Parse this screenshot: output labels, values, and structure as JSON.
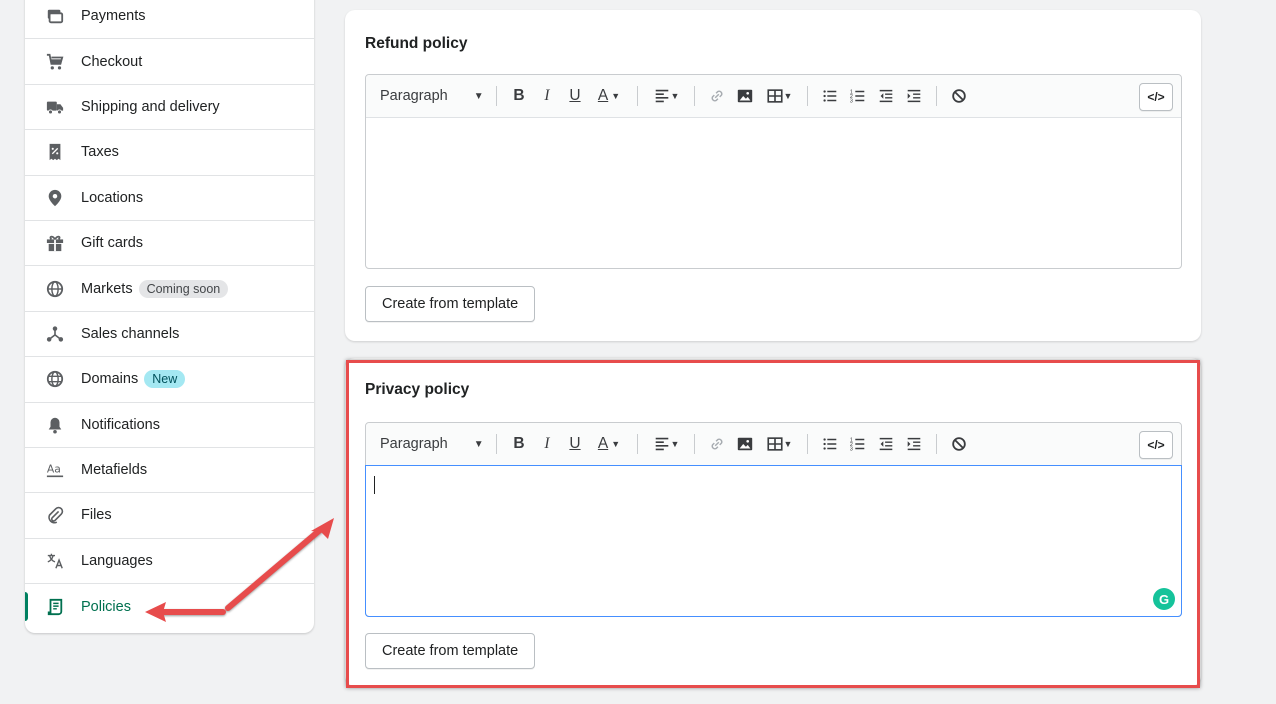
{
  "sidebar": {
    "items": [
      {
        "label": "Payments",
        "icon": "payments-icon"
      },
      {
        "label": "Checkout",
        "icon": "cart-icon"
      },
      {
        "label": "Shipping and delivery",
        "icon": "truck-icon"
      },
      {
        "label": "Taxes",
        "icon": "tax-receipt-icon"
      },
      {
        "label": "Locations",
        "icon": "location-pin-icon"
      },
      {
        "label": "Gift cards",
        "icon": "gift-icon"
      },
      {
        "label": "Markets",
        "icon": "globe-icon",
        "badge": "Coming soon"
      },
      {
        "label": "Sales channels",
        "icon": "channels-icon"
      },
      {
        "label": "Domains",
        "icon": "domain-globe-icon",
        "badge": "New"
      },
      {
        "label": "Notifications",
        "icon": "bell-icon"
      },
      {
        "label": "Metafields",
        "icon": "metafields-icon"
      },
      {
        "label": "Files",
        "icon": "paperclip-icon"
      },
      {
        "label": "Languages",
        "icon": "translate-icon"
      },
      {
        "label": "Policies",
        "icon": "policy-document-icon",
        "active": true
      }
    ]
  },
  "refund": {
    "title": "Refund policy",
    "paragraph": "Paragraph",
    "template_button": "Create from template"
  },
  "privacy": {
    "title": "Privacy policy",
    "paragraph": "Paragraph",
    "template_button": "Create from template"
  },
  "toolbar": {
    "bold": "B",
    "italic": "I",
    "underline": "U",
    "text_color": "A",
    "code": "</>"
  },
  "grammarly": "G",
  "colors": {
    "accent_green": "#008060",
    "highlight_red": "#e74c4c",
    "focus_blue": "#458fff"
  }
}
